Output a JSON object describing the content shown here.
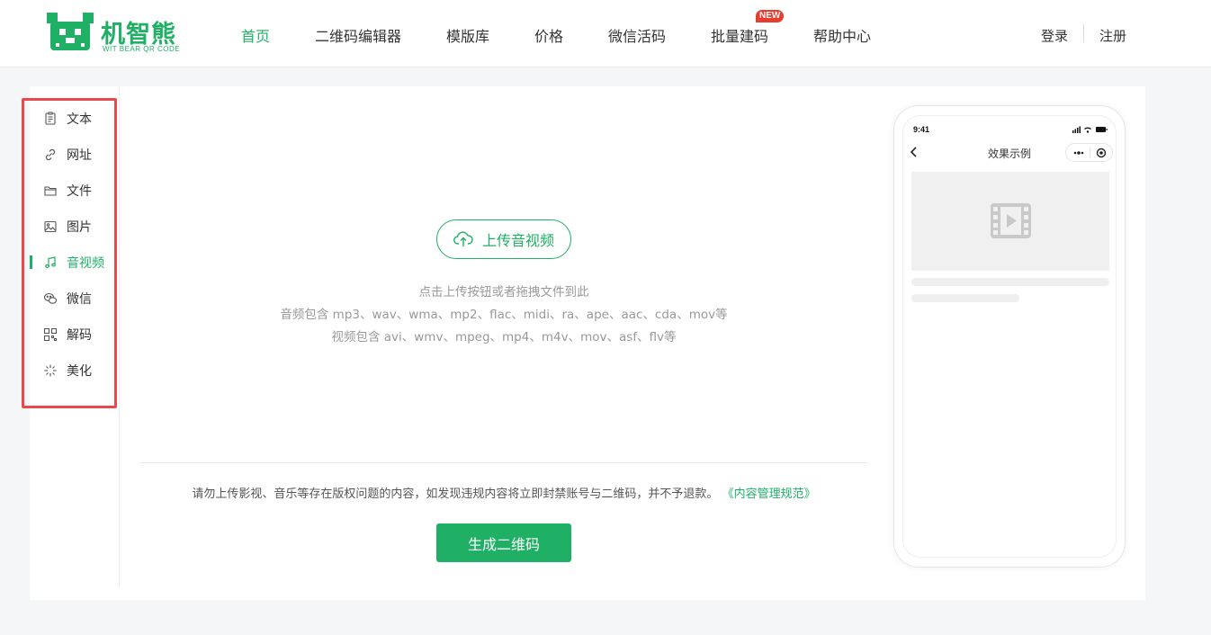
{
  "header": {
    "logo": {
      "text": "机智熊",
      "subtitle": "WIT BEAR QR CODE"
    },
    "nav": [
      {
        "label": "首页",
        "active": true
      },
      {
        "label": "二维码编辑器"
      },
      {
        "label": "模版库"
      },
      {
        "label": "价格"
      },
      {
        "label": "微信活码"
      },
      {
        "label": "批量建码",
        "badge": "NEW"
      },
      {
        "label": "帮助中心"
      }
    ],
    "login": "登录",
    "register": "注册"
  },
  "sidebar": {
    "items": [
      {
        "label": "文本",
        "icon": "document-icon"
      },
      {
        "label": "网址",
        "icon": "link-icon"
      },
      {
        "label": "文件",
        "icon": "folder-icon"
      },
      {
        "label": "图片",
        "icon": "image-icon"
      },
      {
        "label": "音视频",
        "icon": "music-note-icon",
        "active": true
      },
      {
        "label": "微信",
        "icon": "wechat-icon"
      },
      {
        "label": "解码",
        "icon": "qr-grid-icon"
      },
      {
        "label": "美化",
        "icon": "sparkle-icon"
      }
    ]
  },
  "upload": {
    "button_label": "上传音视频",
    "hint_line1": "点击上传按钮或者拖拽文件到此",
    "hint_line2": "音频包含 mp3、wav、wma、mp2、flac、midi、ra、ape、aac、cda、mov等",
    "hint_line3": "视频包含 avi、wmv、mpeg、mp4、m4v、mov、asf、flv等"
  },
  "notice": {
    "text": "请勿上传影视、音乐等存在版权问题的内容，如发现违规内容将立即封禁账号与二维码，并不予退款。",
    "link": "《内容管理规范》"
  },
  "generate_button": "生成二维码",
  "preview": {
    "time": "9:41",
    "title": "效果示例"
  },
  "colors": {
    "brand": "#1fb066",
    "badge": "#e63d2e",
    "highlight_border": "#e8484e"
  }
}
